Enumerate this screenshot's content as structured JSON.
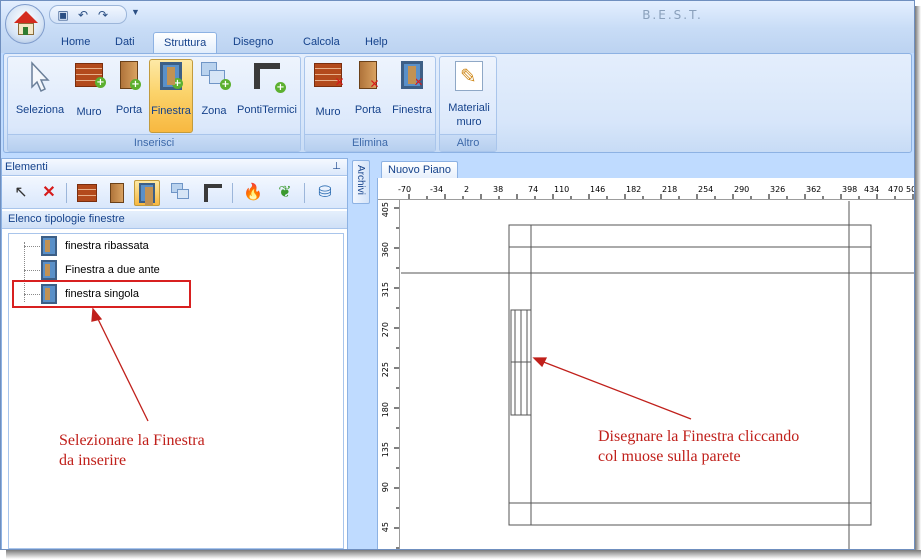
{
  "app": {
    "title": "B.E.S.T."
  },
  "tabs": [
    "Home",
    "Dati",
    "Struttura",
    "Disegno",
    "Calcola",
    "Help"
  ],
  "active_tab": "Struttura",
  "ribbon": {
    "inserisci": {
      "title": "Inserisci",
      "buttons": [
        "Seleziona",
        "Muro",
        "Porta",
        "Finestra",
        "Zona",
        "PontiTermici"
      ]
    },
    "elimina": {
      "title": "Elimina",
      "buttons": [
        "Muro",
        "Porta",
        "Finestra"
      ]
    },
    "altro": {
      "title": "Altro",
      "buttons": [
        "Materiali muro"
      ]
    }
  },
  "left_panel": {
    "title": "Elementi",
    "section_caption": "Elenco tipologie finestre",
    "items": [
      "finestra ribassata",
      "Finestra a due ante",
      "finestra singola"
    ]
  },
  "archivi": {
    "label": "Archivi"
  },
  "drawing": {
    "tab_label": "Nuovo Piano",
    "ruler_x": [
      "-70",
      "-34",
      "2",
      "38",
      "74",
      "110",
      "146",
      "182",
      "218",
      "254",
      "290",
      "326",
      "362",
      "398",
      "434",
      "470",
      "50"
    ],
    "ruler_y": [
      "405",
      "360",
      "315",
      "270",
      "225",
      "180",
      "135",
      "90",
      "45"
    ]
  },
  "annotations": {
    "left": [
      "Selezionare la Finestra",
      "da inserire"
    ],
    "right": [
      "Disegnare la Finestra cliccando",
      "col muose sulla parete"
    ],
    "color": "#c0201b"
  },
  "colors": {
    "ribbon_bg": "#d7e6fa",
    "selected_button": "#fbd36b",
    "text": "#15428b",
    "annotation": "#c0201b"
  }
}
